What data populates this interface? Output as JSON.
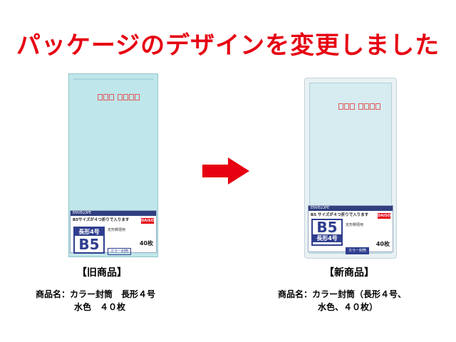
{
  "headline": "パッケージのデザインを変更しました",
  "colors": {
    "headline": "#e60012",
    "arrow": "#e60012",
    "envelope": "#bfe6ea",
    "label_navy": "#2f3f8f"
  },
  "old_product": {
    "title": "【旧商品】",
    "name_line1": "商品名：カラー封筒　長形４号",
    "name_line2": "水色　４０枚",
    "package": {
      "strip_text": "ENVELOPE",
      "subtitle": "B5サイズが４つ折りで入ります",
      "size_top": "長形4号",
      "size_big": "B5",
      "small_text": "定形郵便用",
      "brand": "DAISO",
      "count": "40枚",
      "pill": "カラー封筒"
    }
  },
  "new_product": {
    "title": "【新商品】",
    "name_line1": "商品名：カラー封筒（長形４号、",
    "name_line2": "水色、４０枚）",
    "package": {
      "strip_text": "ENVELOPE",
      "subtitle": "B5 サイズが４つ折りで入ります",
      "size_big": "B5",
      "size_under": "長形4号",
      "small_text": "定形郵便用",
      "brand": "DAISO",
      "count": "40枚",
      "pill": "カラー封筒"
    }
  },
  "icons": {
    "arrow": "right-arrow-icon"
  }
}
